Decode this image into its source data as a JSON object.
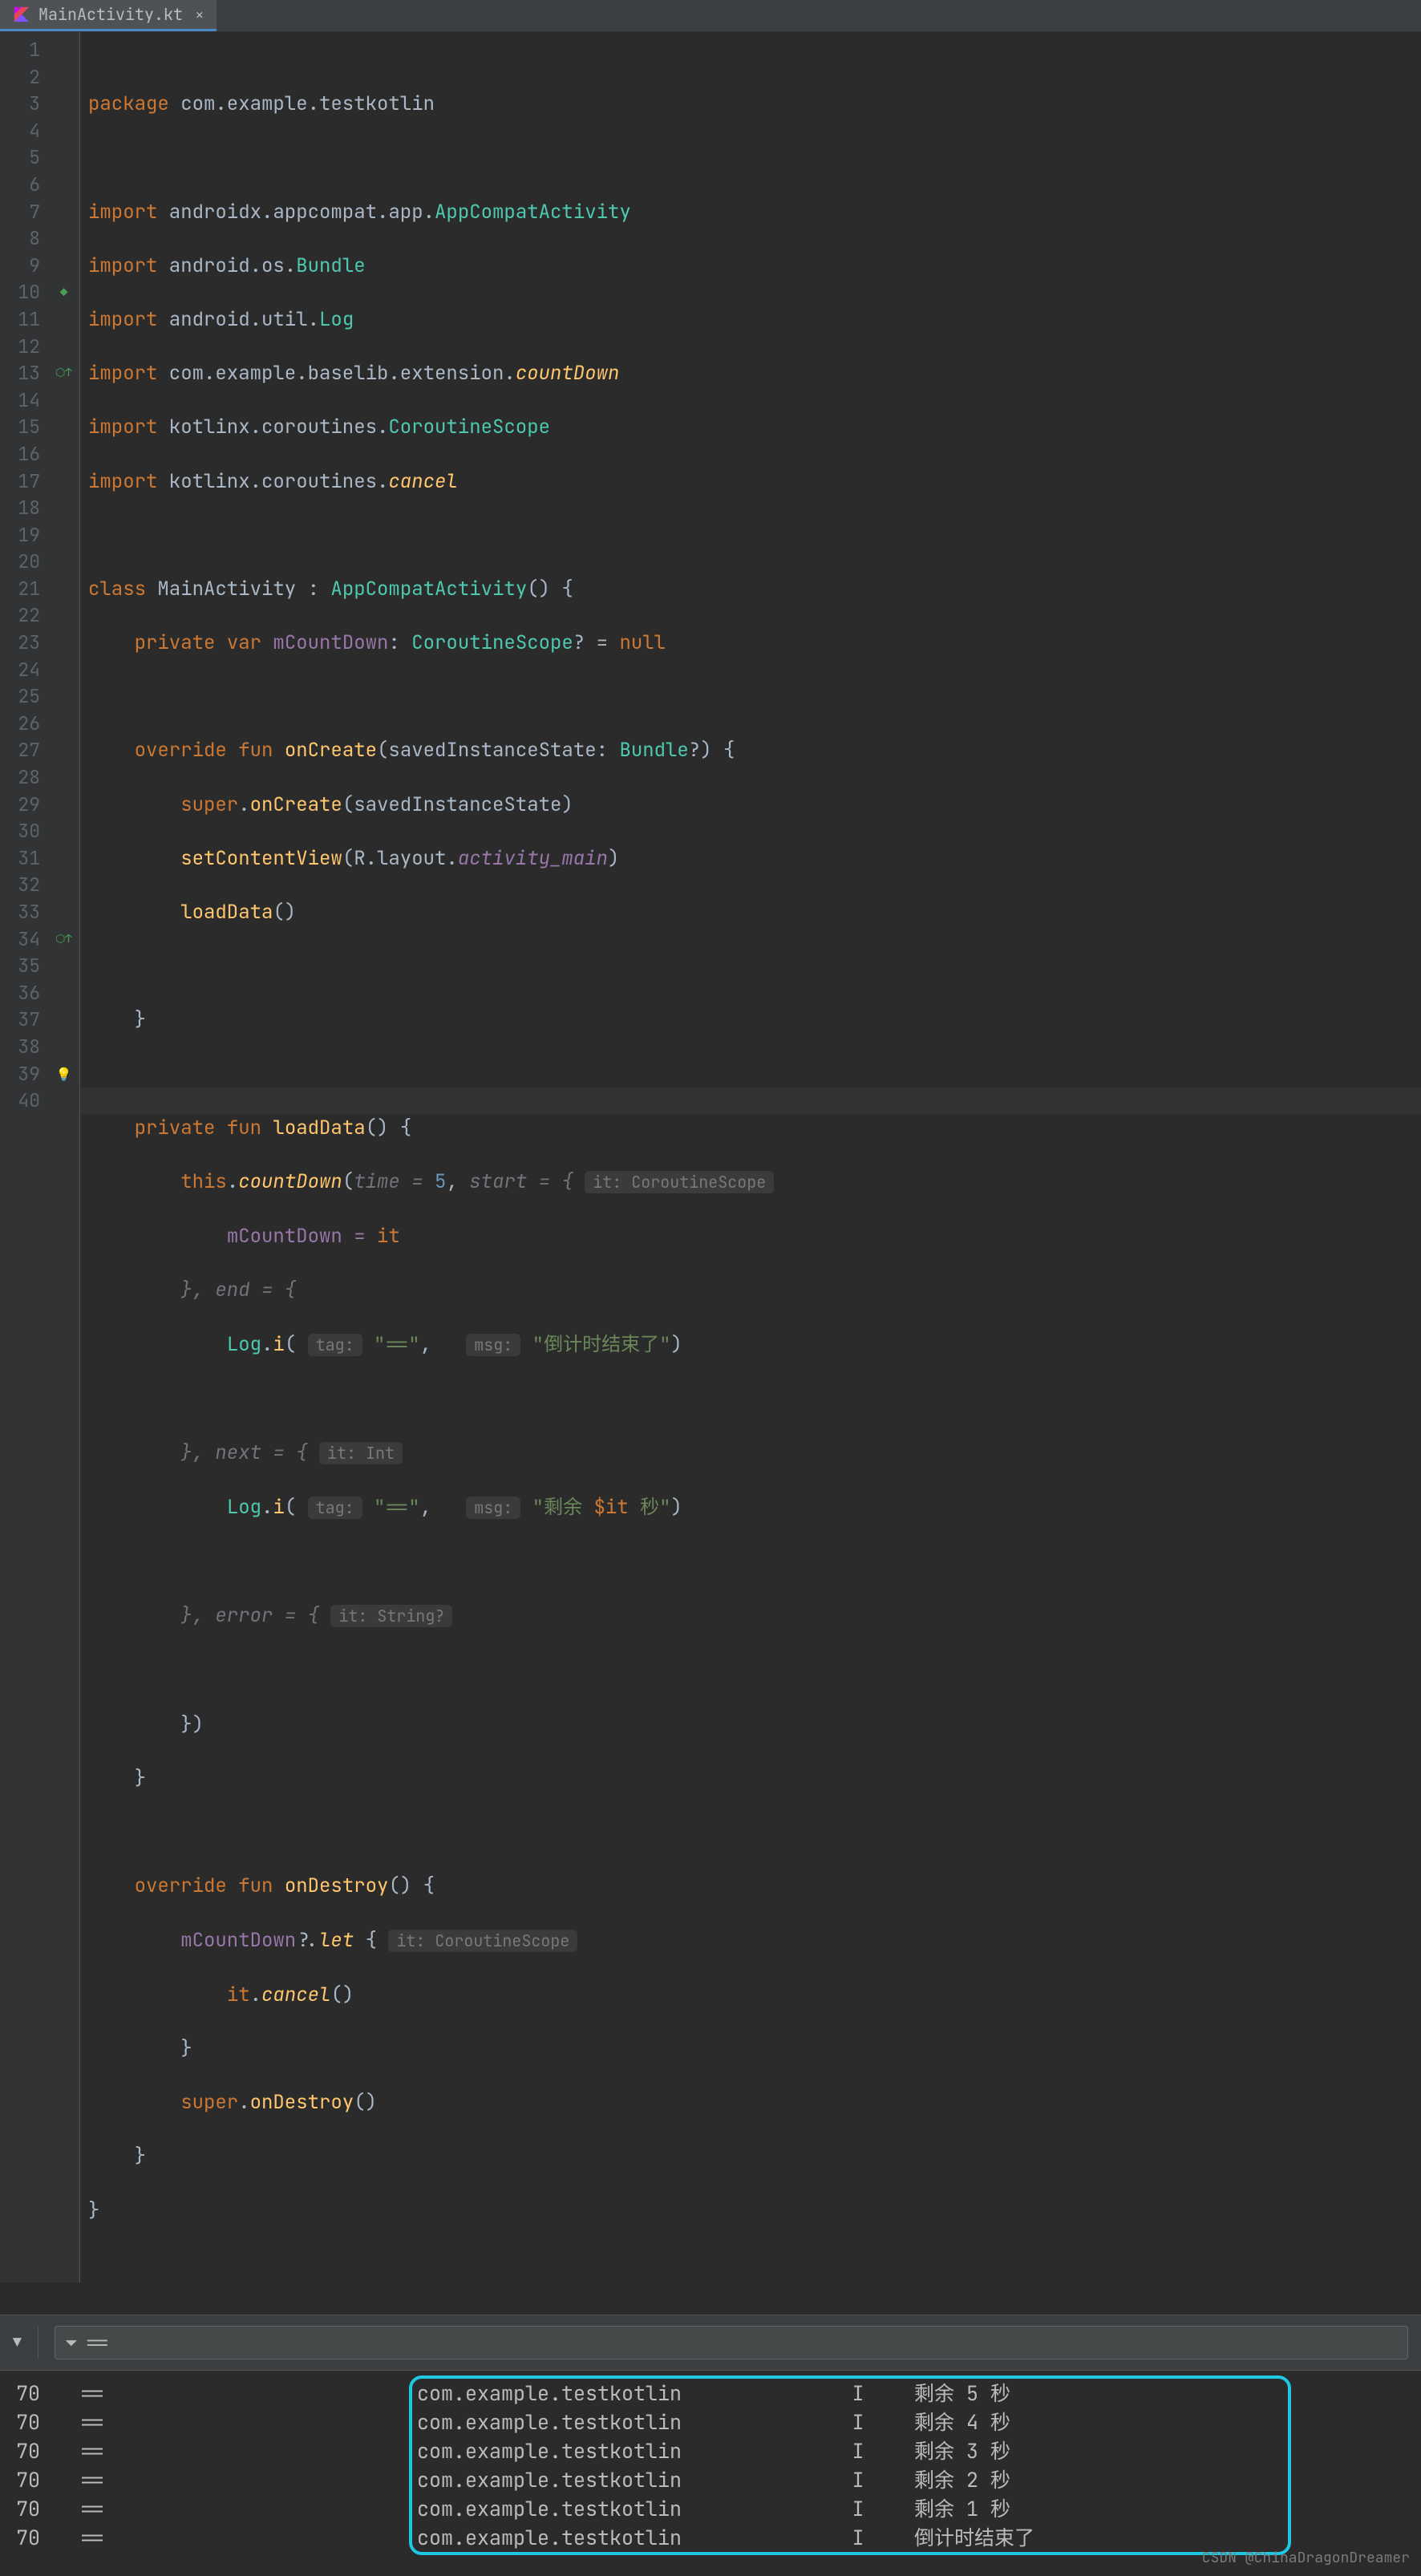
{
  "tab": {
    "filename": "MainActivity.kt"
  },
  "gutter": {
    "lines": 40
  },
  "code": {
    "package_kw": "package",
    "package_name": " com.example.testkotlin",
    "import_kw": "import",
    "imp1a": " androidx.appcompat.app.",
    "imp1b": "AppCompatActivity",
    "imp2a": " android.os.",
    "imp2b": "Bundle",
    "imp3a": " android.util.",
    "imp3b": "Log",
    "imp4a": " com.example.baselib.extension.",
    "imp4b": "countDown",
    "imp5a": " kotlinx.coroutines.",
    "imp5b": "CoroutineScope",
    "imp6a": " kotlinx.coroutines.",
    "imp6b": "cancel",
    "class_kw": "class ",
    "class_name": "MainActivity",
    " extends": " : ",
    "super": "AppCompatActivity",
    "paren": "() {",
    "private": "private ",
    "var": "var ",
    "field": "mCountDown",
    "colon": ": ",
    "scope": "CoroutineScope",
    "nullable": "? = ",
    "null": "null",
    "override": "override ",
    "fun": "fun ",
    "oncreate": "onCreate",
    "oncreate_params": "(savedInstanceState: ",
    "bundle": "Bundle",
    "q": "?) {",
    "super_call": "super",
    "dot": ".",
    "oncreate_call": "onCreate",
    "sis": "(savedInstanceState)",
    "setcontent": "setContentView",
    "r": "(R.layout.",
    "layout": "activity_main",
    ")": ")",
    "loaddata": "loadData",
    "empty": "()",
    "brace": "}",
    "loaddata_sig": "loadData",
    "loaddata_paren": "() {",
    "this": "this",
    "countdown": "countDown",
    "open": "(",
    "time_p": "time = ",
    "five": "5",
    ", ": "",
    "start_p": "start = {",
    "hint_scope": "it: CoroutineScope",
    "assign": "mCountDown = ",
    "it": "it",
    "end_p": "}, end = {",
    "log": "Log",
    "i": "i",
    "open2": "(",
    "tag_hint": "tag:",
    "eq_str": "\"==\"",
    "comma": ",  ",
    "msg_hint": "msg:",
    "end_str": "\"倒计时结束了\"",
    ")2": ")",
    "next_p": "}, next = {",
    "hint_int": "it: Int",
    "next_str_a": "\"剩余 ",
    "dollar": "$",
    "it2": "it",
    "next_str_b": " 秒\"",
    "error_p": "}, error = {",
    "hint_str": "it: String?",
    "close_lambda": "})",
    "ondestroy": "onDestroy",
    "ondestroy_paren": "() {",
    "field2": "mCountDown",
    "qm": "?.",
    "let": "let",
    " open_let": " {",
    "it3": "it",
    "cancel": "cancel",
    "super2": "super",
    "ondestroy2": "onDestroy"
  },
  "filter": {
    "text": "=="
  },
  "log": {
    "rows": [
      {
        "t": "70",
        "tag": "==",
        "pkg": "com.example.testkotlin",
        "lvl": "I",
        "msg": "剩余 5 秒"
      },
      {
        "t": "70",
        "tag": "==",
        "pkg": "com.example.testkotlin",
        "lvl": "I",
        "msg": "剩余 4 秒"
      },
      {
        "t": "70",
        "tag": "==",
        "pkg": "com.example.testkotlin",
        "lvl": "I",
        "msg": "剩余 3 秒"
      },
      {
        "t": "70",
        "tag": "==",
        "pkg": "com.example.testkotlin",
        "lvl": "I",
        "msg": "剩余 2 秒"
      },
      {
        "t": "70",
        "tag": "==",
        "pkg": "com.example.testkotlin",
        "lvl": "I",
        "msg": "剩余 1 秒"
      },
      {
        "t": "70",
        "tag": "==",
        "pkg": "com.example.testkotlin",
        "lvl": "I",
        "msg": "倒计时结束了"
      }
    ]
  },
  "watermark": "CSDN @ChinaDragonDreamer"
}
